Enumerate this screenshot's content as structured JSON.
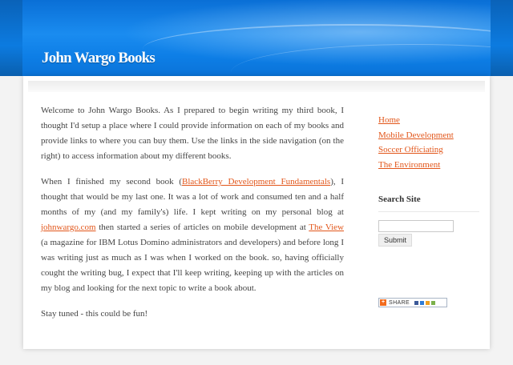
{
  "header": {
    "site_title": "John Wargo Books"
  },
  "main": {
    "p1": "Welcome to John Wargo Books. As I prepared to begin writing my third book, I thought I'd setup a place where I could provide information on each of my books and provide links to where you can buy them. Use the links in the side navigation (on the right) to access information about my different books.",
    "p2_before_link1": "When I finished my second book (",
    "p2_link1": "BlackBerry Development Fundamentals",
    "p2_between_1_2": "), I thought that would be my last one. It was a lot of work and consumed ten and a half months of my (and my family's) life. I kept writing on my personal blog at ",
    "p2_link2": "johnwargo.com",
    "p2_between_2_3": " then started a series of articles on mobile development at ",
    "p2_link3": "The View",
    "p2_after_link3": " (a magazine for IBM Lotus Domino administrators and developers) and before long I was writing just as much as I was when I worked on the book. so, having officially cought the writing bug, I expect that I'll keep writing, keeping up with the articles on my blog and looking for the next topic to write a book about.",
    "p3": "Stay tuned - this could be fun!"
  },
  "sidebar": {
    "nav": [
      "Home",
      "Mobile Development",
      "Soccer Officiating",
      "The Environment"
    ],
    "search_title": "Search Site",
    "search_value": "",
    "submit_label": "Submit",
    "share_label": "SHARE",
    "share_icon": "plus-icon"
  },
  "colors": {
    "link": "#e2561a",
    "banner": "#0c7be0",
    "text": "#444444"
  }
}
